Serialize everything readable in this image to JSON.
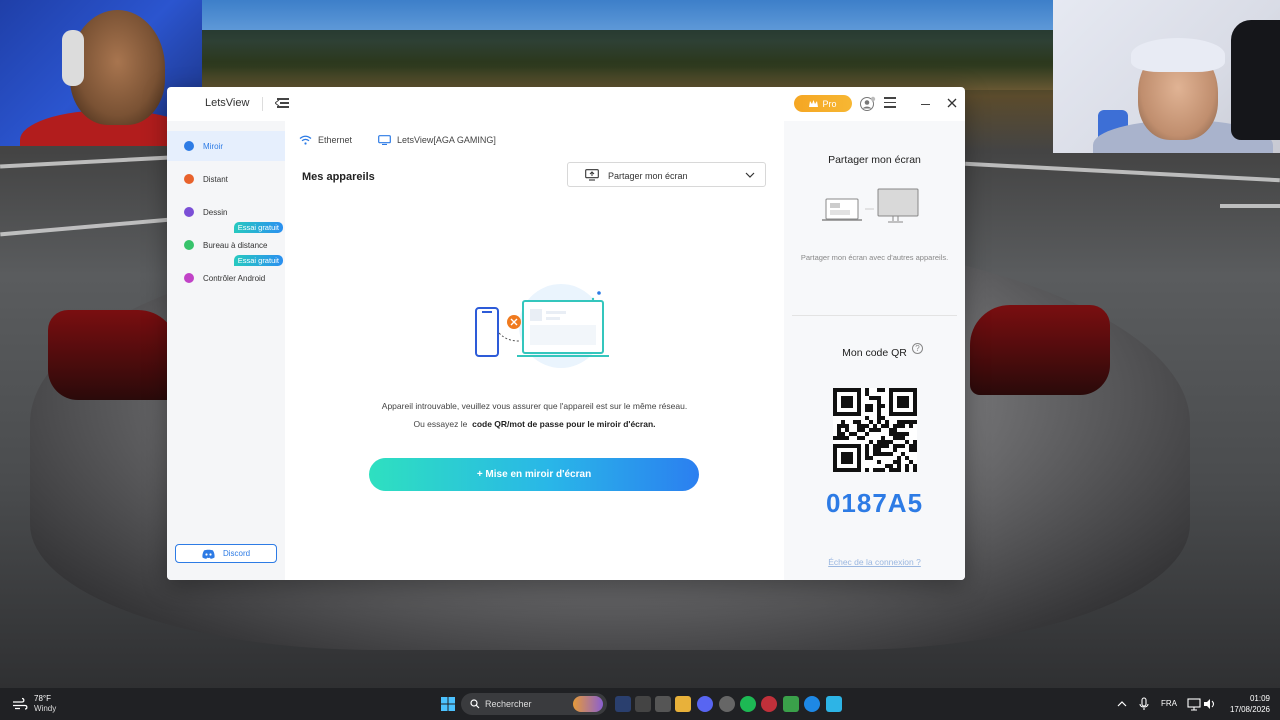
{
  "app": {
    "name": "LetsView",
    "pro_label": "Pro"
  },
  "sidebar": {
    "items": [
      {
        "label": "Miroir",
        "color": "#2d7be5",
        "active": true,
        "badge": ""
      },
      {
        "label": "Distant",
        "color": "#e8622c",
        "active": false,
        "badge": ""
      },
      {
        "label": "Dessin",
        "color": "#7b4fd6",
        "active": false,
        "badge": ""
      },
      {
        "label": "Bureau à distance",
        "color": "#37c36b",
        "active": false,
        "badge": "Essai gratuit"
      },
      {
        "label": "Contrôler Android",
        "color": "#c143c7",
        "active": false,
        "badge": "Essai gratuit"
      }
    ],
    "discord_label": "Discord"
  },
  "main": {
    "network": "Ethernet",
    "device_name": "LetsView[AGA GAMING]",
    "devices_title": "Mes appareils",
    "share_select_value": "Partager mon écran",
    "message_line1": "Appareil introuvable, veuillez vous assurer que l'appareil est sur le même réseau.",
    "message_line2_prefix": "Ou essayez le",
    "message_line2_bold": "code QR/mot de passe pour le miroir d'écran.",
    "mirror_button": "+ Mise en miroir d'écran"
  },
  "right_panel": {
    "share_title": "Partager mon écran",
    "share_desc": "Partager mon écran avec d'autres appareils.",
    "qr_title": "Mon code QR",
    "qr_help": "?",
    "code": "0187A5",
    "fail_link": "Échec de la connexion ?"
  },
  "taskbar": {
    "temp": "78°F",
    "condition": "Windy",
    "search_label": "Rechercher",
    "language": "FRA",
    "time": "01:09",
    "date": "17/08/2026"
  },
  "colors": {
    "accent": "#2d7be5",
    "pro": "#f5a623"
  }
}
